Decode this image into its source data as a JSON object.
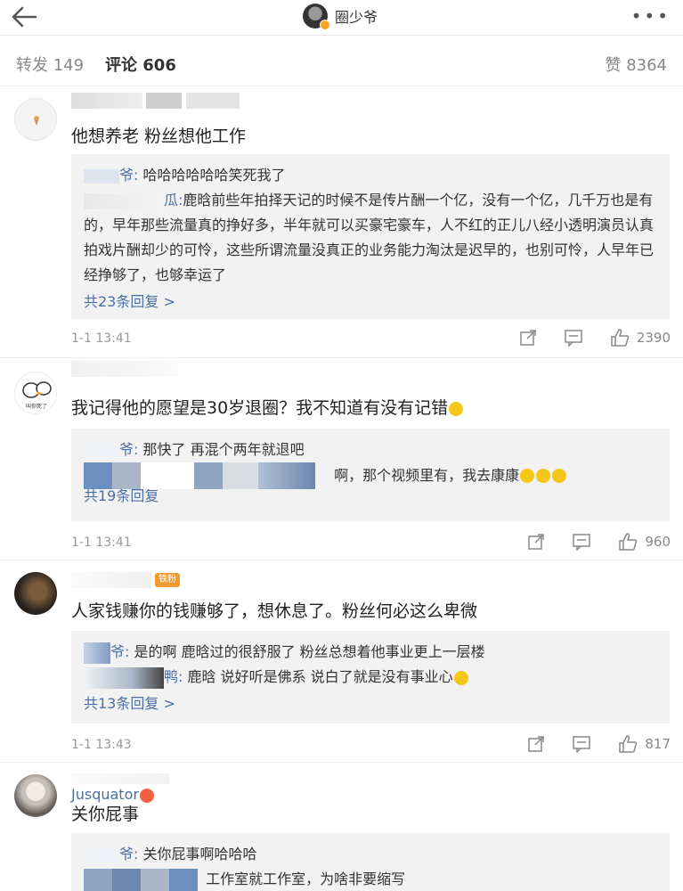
{
  "header": {
    "username": "圈少爷",
    "more_icon": "more-dots-icon"
  },
  "tabs": {
    "repost": "转发 149",
    "comment": "评论 606",
    "like": "赞 8364"
  },
  "comments": [
    {
      "text": "他想养老  粉丝想他工作",
      "replies": [
        {
          "name": "爷:",
          "text": "哈哈哈哈哈哈笑死我了"
        },
        {
          "name": "瓜:",
          "text": "鹿晗前些年拍择天记的时候不是传片酬一个亿，没有一个亿，几千万也是有的，早年那些流量真的挣好多，半年就可以买豪宅豪车，人不红的正儿八经小透明演员认真拍戏片酬却少的可怜，这些所谓流量没真正的业务能力淘汰是迟早的，也别可怜，人早年已经挣够了，也够幸运了"
        }
      ],
      "more": "共23条回复 >",
      "time": "1-1 13:41",
      "likes": "2390"
    },
    {
      "text": "我记得他的愿望是30岁退圈？我不知道有没有记错",
      "replies": [
        {
          "name": "爷:",
          "text": "那快了 再混个两年就退吧"
        },
        {
          "name": "",
          "text": "啊，那个视频里有，我去康康"
        }
      ],
      "more": "共19条回复",
      "time": "1-1 13:41",
      "likes": "960"
    },
    {
      "badge": "铁粉",
      "text": "人家钱赚你的钱赚够了，想休息了。粉丝何必这么卑微",
      "replies": [
        {
          "name": "爷:",
          "text": "是的啊 鹿晗过的很舒服了 粉丝总想着他事业更上一层楼"
        },
        {
          "name": "鸭:",
          "text": "鹿晗 说好听是佛系 说白了就是没有事业心"
        }
      ],
      "more": "共13条回复 >",
      "time": "1-1 13:43",
      "likes": "817"
    },
    {
      "nick": "Jusquator",
      "text": "关你屁事",
      "replies": [
        {
          "name": "爷:",
          "text": "关你屁事啊哈哈哈"
        },
        {
          "name": "",
          "text": "工作室就工作室，为啥非要缩写"
        }
      ]
    }
  ]
}
